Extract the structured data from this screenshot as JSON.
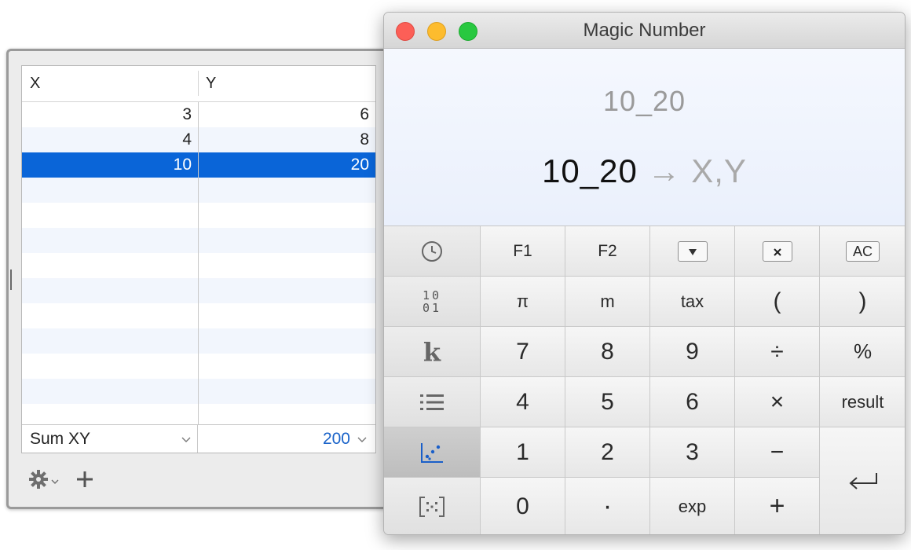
{
  "table": {
    "columns": {
      "x": "X",
      "y": "Y"
    },
    "rows": [
      {
        "x": "3",
        "y": "6",
        "selected": false
      },
      {
        "x": "4",
        "y": "8",
        "selected": false
      },
      {
        "x": "10",
        "y": "20",
        "selected": true
      }
    ],
    "footer": {
      "function_label": "Sum XY",
      "value": "200"
    }
  },
  "window": {
    "title": "Magic Number"
  },
  "display": {
    "input": "10_20",
    "result": "10_20",
    "arrow": "→",
    "conversion": "X,Y"
  },
  "keys": {
    "f1": "F1",
    "f2": "F2",
    "clear_all": "AC",
    "pi": "π",
    "m": "m",
    "tax": "tax",
    "lparen": "(",
    "rparen": ")",
    "seven": "7",
    "eight": "8",
    "nine": "9",
    "divide": "÷",
    "percent": "%",
    "four": "4",
    "five": "5",
    "six": "6",
    "multiply": "×",
    "result": "result",
    "one": "1",
    "two": "2",
    "three": "3",
    "minus": "−",
    "zero": "0",
    "decimal": "·",
    "exp": "exp",
    "plus": "+",
    "bits_top": "10",
    "bits_bottom": "01",
    "k": "k"
  },
  "colors": {
    "selection": "#0a65d8",
    "footer_value": "#1a63c9",
    "chart_icon": "#1a5fc9"
  }
}
